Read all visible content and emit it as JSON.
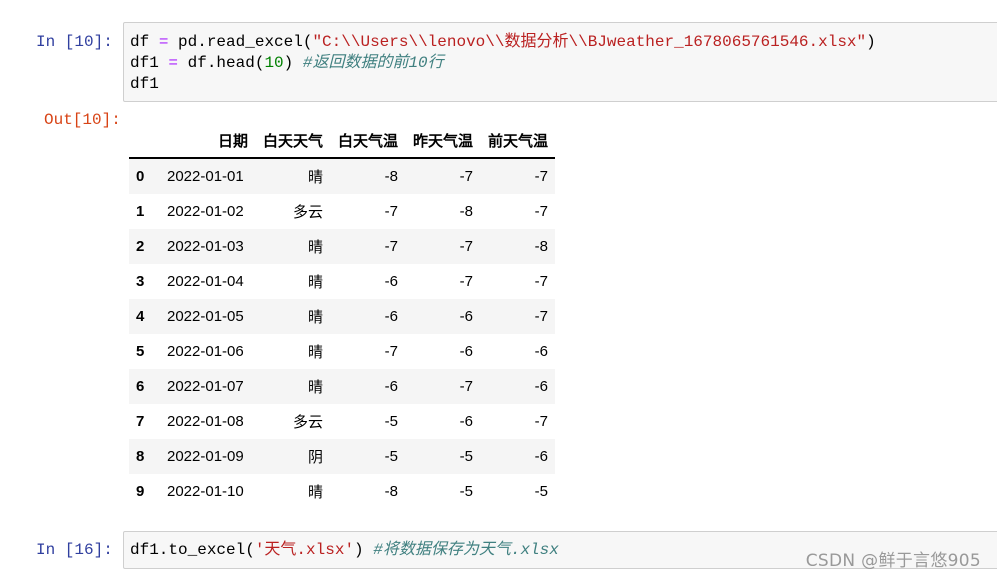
{
  "cells": [
    {
      "prompt": "In  [10]:",
      "lines": [
        [
          [
            "df ",
            "p"
          ],
          [
            "=",
            "op"
          ],
          [
            " pd.read_excel(",
            "p"
          ],
          [
            "\"C:\\\\Users\\\\lenovo\\\\数据分析\\\\BJweather_1678065761546.xlsx\"",
            "str"
          ],
          [
            ")",
            "p"
          ]
        ],
        [
          [
            "df1 ",
            "p"
          ],
          [
            "=",
            "op"
          ],
          [
            " df.head(",
            "p"
          ],
          [
            "10",
            "num"
          ],
          [
            ") ",
            "p"
          ],
          [
            "#返回数据的前10行",
            "cmt"
          ]
        ],
        [
          [
            "df1",
            "p"
          ]
        ]
      ]
    },
    {
      "prompt": "In  [16]:",
      "lines": [
        [
          [
            "df1.to_excel(",
            "p"
          ],
          [
            "'天气.xlsx'",
            "str"
          ],
          [
            ") ",
            "p"
          ],
          [
            "#将数据保存为天气.xlsx",
            "cmt"
          ]
        ]
      ]
    }
  ],
  "output": {
    "prompt": "Out[10]:",
    "columns": [
      "",
      "日期",
      "白天天气",
      "白天气温",
      "昨天气温",
      "前天气温"
    ],
    "rows": [
      [
        "0",
        "2022-01-01",
        "晴",
        "-8",
        "-7",
        "-7"
      ],
      [
        "1",
        "2022-01-02",
        "多云",
        "-7",
        "-8",
        "-7"
      ],
      [
        "2",
        "2022-01-03",
        "晴",
        "-7",
        "-7",
        "-8"
      ],
      [
        "3",
        "2022-01-04",
        "晴",
        "-6",
        "-7",
        "-7"
      ],
      [
        "4",
        "2022-01-05",
        "晴",
        "-6",
        "-6",
        "-7"
      ],
      [
        "5",
        "2022-01-06",
        "晴",
        "-7",
        "-6",
        "-6"
      ],
      [
        "6",
        "2022-01-07",
        "晴",
        "-6",
        "-7",
        "-6"
      ],
      [
        "7",
        "2022-01-08",
        "多云",
        "-5",
        "-6",
        "-7"
      ],
      [
        "8",
        "2022-01-09",
        "阴",
        "-5",
        "-5",
        "-6"
      ],
      [
        "9",
        "2022-01-10",
        "晴",
        "-8",
        "-5",
        "-5"
      ]
    ]
  },
  "watermark": "CSDN @鲜于言悠905",
  "colors": {
    "in_prompt": "#303f9f",
    "out_prompt": "#d84315",
    "string": "#ba2121",
    "number": "#008000",
    "operator": "#aa22ff",
    "comment": "#408080",
    "cell_bg": "#f7f7f7",
    "cell_border": "#cfcfcf"
  }
}
